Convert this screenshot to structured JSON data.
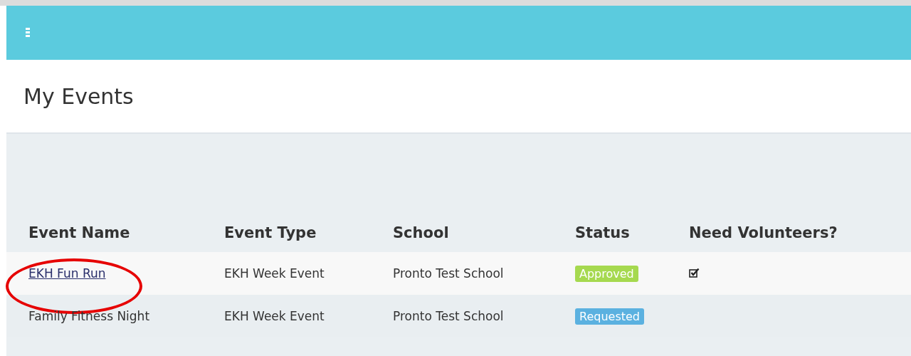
{
  "page_title": "My Events",
  "table": {
    "columns": [
      "Event Name",
      "Event Type",
      "School",
      "Status",
      "Need Volunteers?"
    ],
    "rows": [
      {
        "name": "EKH Fun Run",
        "link": true,
        "circled": true,
        "type": "EKH Week Event",
        "school": "Pronto Test School",
        "status": {
          "label": "Approved",
          "color": "#a6d94f"
        },
        "volunteers": true
      },
      {
        "name": "Family Fitness Night",
        "link": false,
        "circled": false,
        "type": "EKH Week Event",
        "school": "Pronto Test School",
        "status": {
          "label": "Requested",
          "color": "#5bb1e0"
        },
        "volunteers": false
      }
    ]
  }
}
